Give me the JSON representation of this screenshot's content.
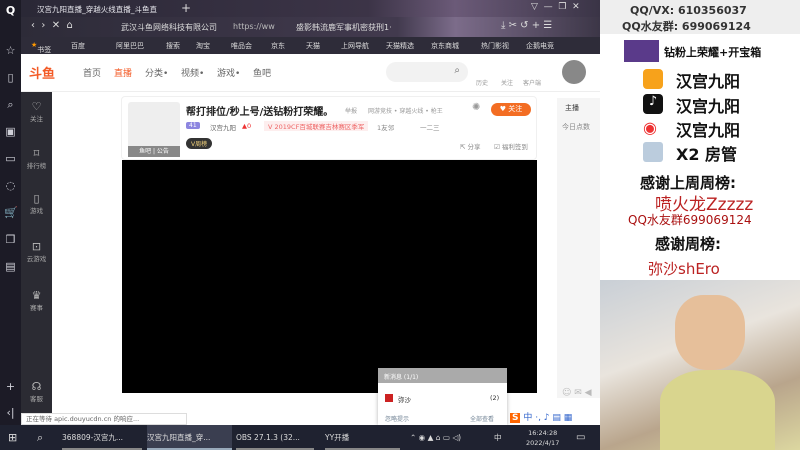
{
  "browser": {
    "tab_title": "汉宫九阳直播_穿越火线直播_斗鱼直",
    "site_owner": "武汉斗鱼网络科技有限公司",
    "url": "https://ww",
    "search_hint": "盛影韩流鹿军事机密获刑1·",
    "bookmarks": [
      "书签",
      "百度",
      "阿里巴巴",
      "搜索",
      "淘宝",
      "唯品会",
      "京东",
      "天猫",
      "上网导航",
      "天猫精选",
      "京东商城",
      "热门影视",
      "企鹅电竞"
    ],
    "status": "正在等待 apic.douyucdn.cn 的响应..."
  },
  "douyu": {
    "logo": "斗鱼",
    "nav": [
      "首页",
      "直播",
      "分类•",
      "视频•",
      "游戏•",
      "鱼吧"
    ],
    "top_icons": [
      "历史",
      "关注",
      "客户端"
    ],
    "sidebar": [
      "关注",
      "排行榜",
      "游戏",
      "云游戏",
      "赛事",
      "客服"
    ],
    "room": {
      "title": "帮打排位/秒上号/送钻粉打荣耀。",
      "report": "举报",
      "category": "网游竞技 • 穿越火线 • 枪王",
      "level": "41",
      "streamer": "汉宫九阳",
      "hot": "0",
      "award": "2019CF百城联赛吉林赛区季军",
      "fans": "1友邻",
      "tag": "一二三",
      "follow": "关注",
      "share": "分享",
      "sign": "福利签到",
      "fishbar": "鱼吧",
      "notice": "公告",
      "vbadge": "V周榜"
    },
    "right": {
      "tab": "主播",
      "rank_label": "今日点数"
    }
  },
  "popup": {
    "title": "新消息 (1/1)",
    "sender": "弥沙",
    "count": "(2)",
    "ignore": "忽略提示",
    "view_all": "全部查看"
  },
  "taskbar": {
    "items": [
      "368809-汉宫九...",
      "汉宫九阳直播_穿...",
      "OBS 27.1.3 (32...",
      "YY开播"
    ],
    "ime": "中",
    "time": "16:24:28",
    "date": "2022/4/17"
  },
  "overlay": {
    "qq": "QQ/VX: 610356037",
    "group": "QQ水友群: 699069124",
    "promo": "钻粉上荣耀+开宝箱",
    "accounts": [
      "汉宫九阳",
      "汉宫九阳",
      "汉宫九阳"
    ],
    "manager": "X2 房管",
    "last_week": "感谢上周周榜:",
    "last_week_name": "喷火龙Zzzzz",
    "group2": "QQ水友群699069124",
    "this_week": "感谢周榜:",
    "this_week_name": "弥沙shEro"
  }
}
